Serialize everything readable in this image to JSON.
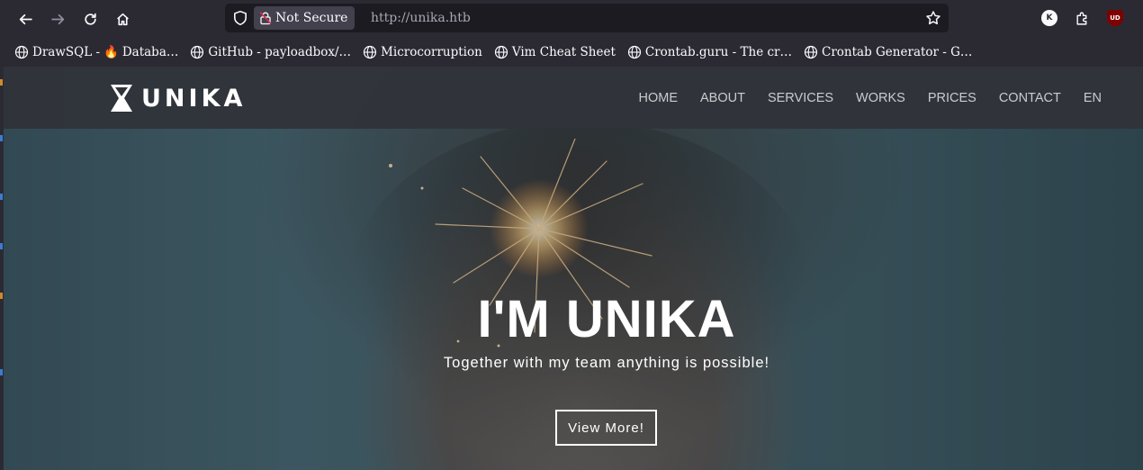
{
  "browser": {
    "security_label": "Not Secure",
    "url": "http://unika.htb",
    "extensions": [
      {
        "icon": "k-extension-icon",
        "text": "K"
      },
      {
        "icon": "puzzle-extensions-icon",
        "text": ""
      },
      {
        "icon": "ublock-origin-icon",
        "text": "UD"
      }
    ]
  },
  "bookmarks": [
    {
      "label": "DrawSQL - ",
      "emoji": "🔥",
      "label2": " Databa…"
    },
    {
      "label": "GitHub - payloadbox/…"
    },
    {
      "label": "Microcorruption"
    },
    {
      "label": "Vim Cheat Sheet"
    },
    {
      "label": "Crontab.guru - The cr…"
    },
    {
      "label": "Crontab Generator - G…"
    }
  ],
  "site": {
    "logo_text": "UNIKA",
    "nav": [
      "HOME",
      "ABOUT",
      "SERVICES",
      "WORKS",
      "PRICES",
      "CONTACT",
      "EN"
    ],
    "hero_title": "I'M UNIKA",
    "hero_subtitle": "Together with my team anything is possible!",
    "cta_label": "View More!"
  },
  "colors": {
    "browser_chrome": "#2b2a33",
    "url_field": "#1c1b22",
    "nav_bar": "#31343a",
    "accent_white": "#ffffff"
  }
}
